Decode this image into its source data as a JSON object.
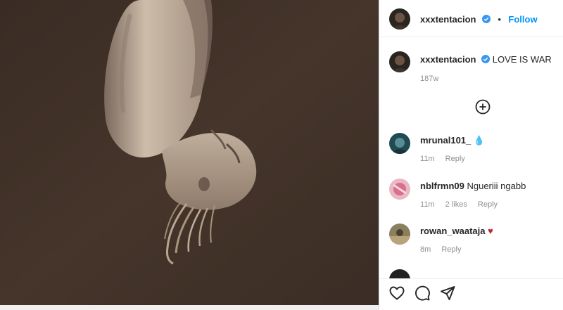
{
  "post": {
    "author": "xxxtentacion",
    "follow_label": "Follow",
    "separator": "•",
    "caption": "LOVE IS WAR",
    "age": "187w"
  },
  "comments": [
    {
      "user": "mrunal101_",
      "text": "",
      "emoji": "💧",
      "time": "11m",
      "likes": "",
      "reply_label": "Reply"
    },
    {
      "user": "nblfrmn09",
      "text": "Ngueriii ngabb",
      "emoji": "",
      "time": "11m",
      "likes": "2 likes",
      "reply_label": "Reply"
    },
    {
      "user": "rowan_waataja",
      "text": "",
      "emoji": "♥",
      "time": "8m",
      "likes": "",
      "reply_label": "Reply"
    }
  ],
  "icons": {
    "verified": "verified-badge-icon",
    "load_more": "plus-circle-icon",
    "like": "heart-icon",
    "comment": "comment-icon",
    "share": "send-icon"
  },
  "colors": {
    "accent": "#0095f6",
    "verified": "#3897f0",
    "photo_background": "#3f3027",
    "heart_emoji": "#c0262d",
    "muted_text": "#8e8e8e"
  }
}
